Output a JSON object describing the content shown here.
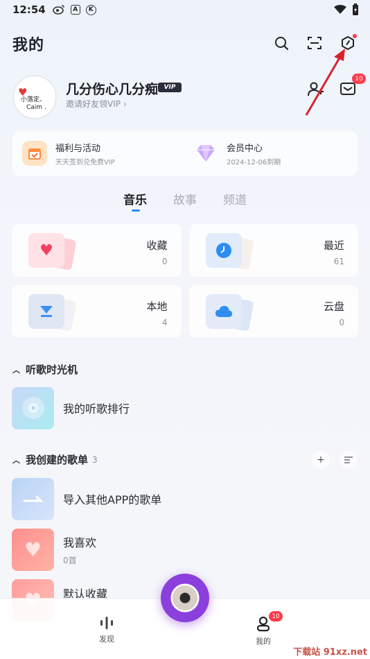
{
  "status_bar": {
    "time": "12:54",
    "icon_a": "A",
    "icon_k": "K"
  },
  "header": {
    "title": "我的"
  },
  "profile": {
    "avatar_text_1": "小落定、",
    "avatar_text_2": "Caim .",
    "name": "几分伤心几分痴",
    "vip_label": "VIP",
    "invite_text": "邀请好友领VIP",
    "mail_badge": "10"
  },
  "promo": {
    "items": [
      {
        "title": "福利与活动",
        "subtitle": "天天签到兑免费VIP"
      },
      {
        "title": "会员中心",
        "subtitle": "2024-12-06到期"
      }
    ]
  },
  "tabs": [
    "音乐",
    "故事",
    "频道"
  ],
  "library": [
    {
      "label": "收藏",
      "count": "0"
    },
    {
      "label": "最近",
      "count": "61"
    },
    {
      "label": "本地",
      "count": "4"
    },
    {
      "label": "云盘",
      "count": "0"
    }
  ],
  "time_machine": {
    "heading": "听歌时光机",
    "item": "我的听歌排行"
  },
  "playlists": {
    "heading": "我创建的歌单",
    "count": "3",
    "items": [
      {
        "title": "导入其他APP的歌单",
        "subtitle": ""
      },
      {
        "title": "我喜欢",
        "subtitle": "0首"
      },
      {
        "title": "默认收藏",
        "subtitle": ""
      }
    ]
  },
  "bottom_nav": {
    "discover": "发现",
    "mine": "我的",
    "mine_badge": "10"
  },
  "watermark": "下载站 91xz.net",
  "colors": {
    "accent": "#2a8cf2",
    "badge": "#ff3b4a",
    "play": "#8b3fdc"
  }
}
